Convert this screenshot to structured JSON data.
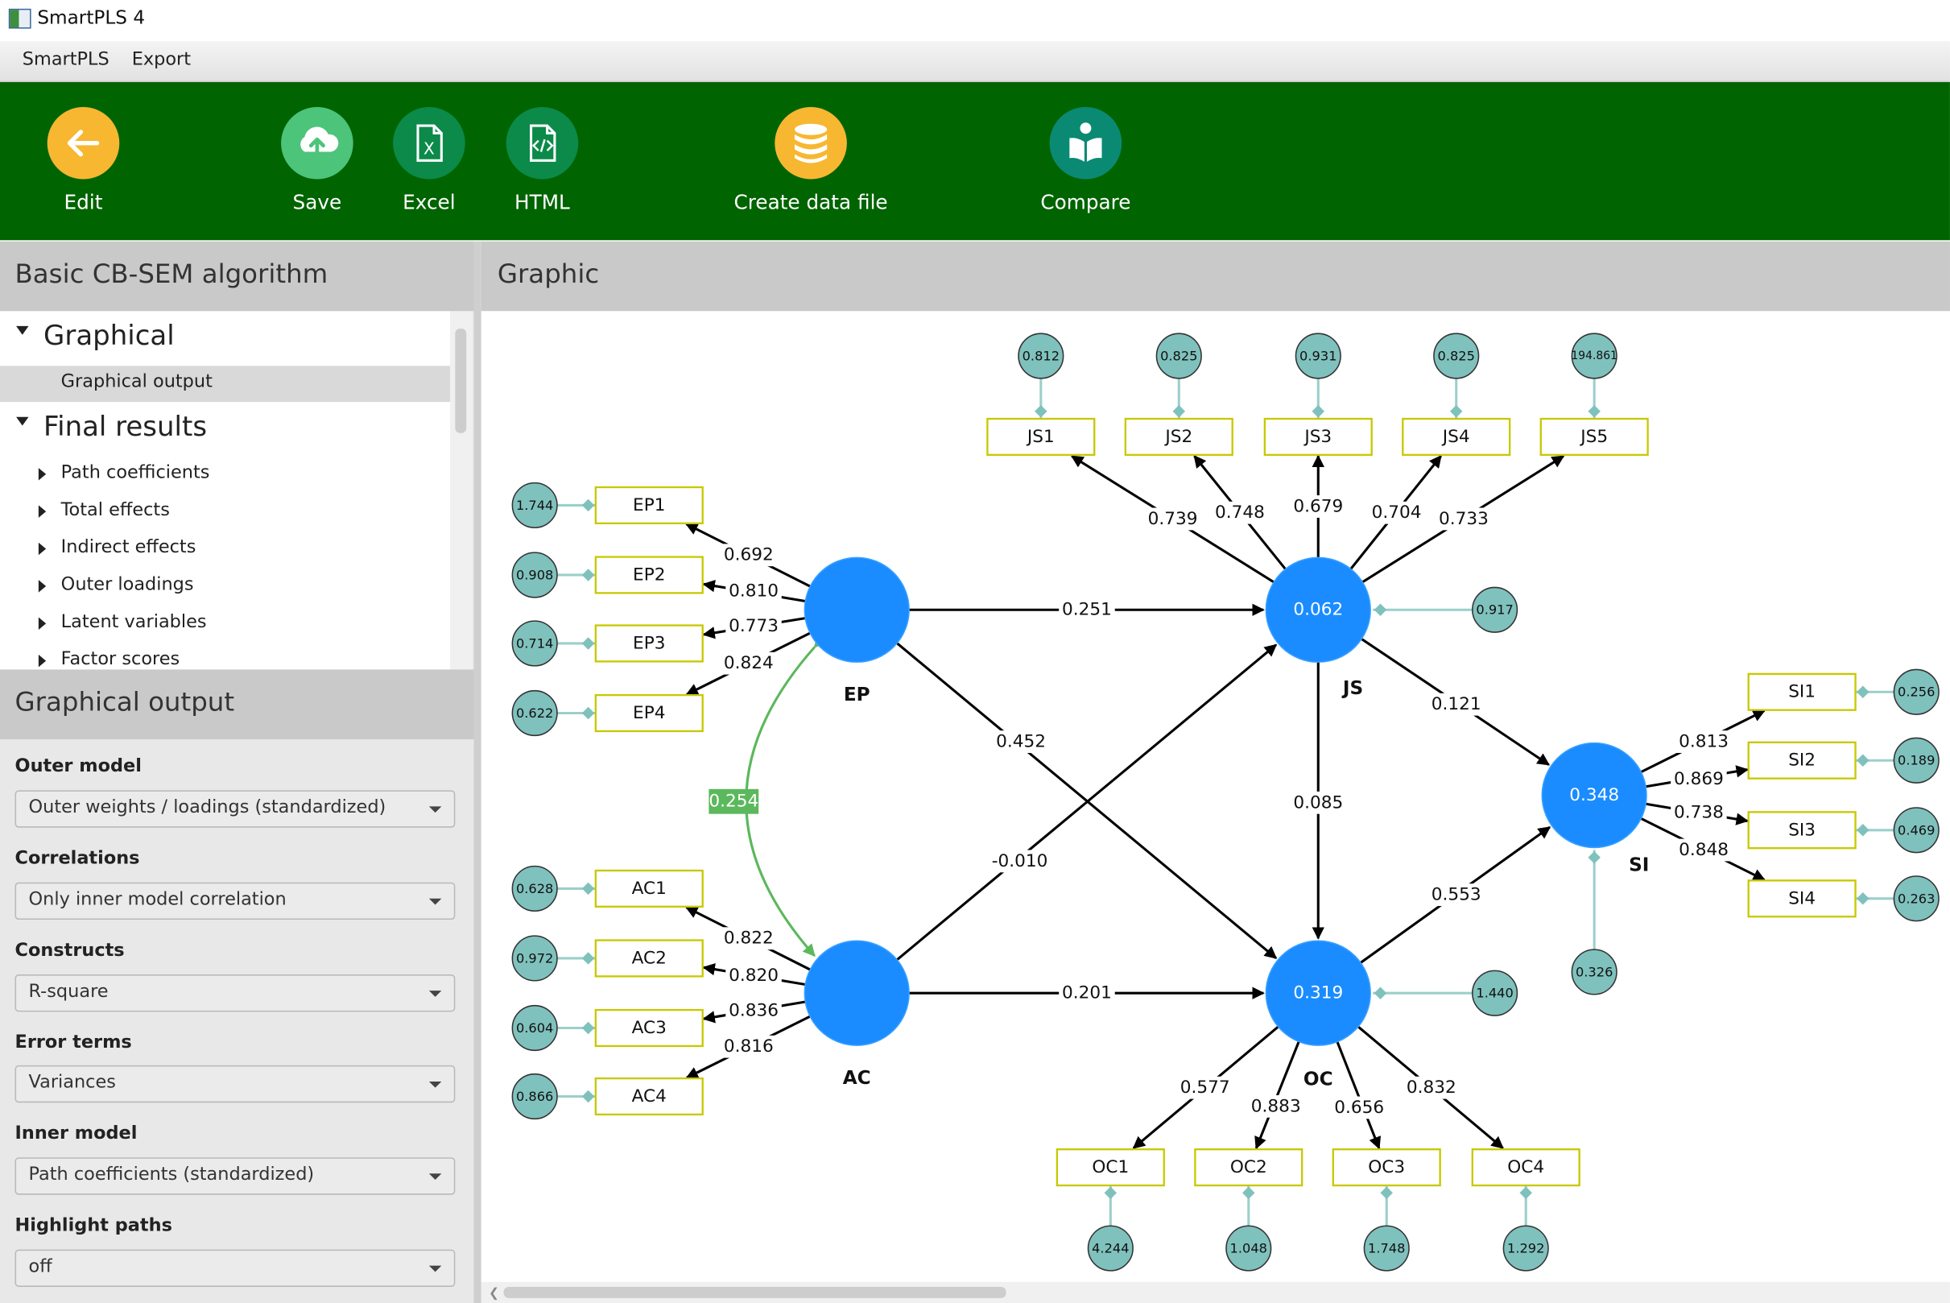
{
  "window": {
    "title": "SmartPLS 4"
  },
  "menu": {
    "items": [
      "SmartPLS",
      "Export"
    ]
  },
  "toolbar": {
    "edit": "Edit",
    "save": "Save",
    "excel": "Excel",
    "html": "HTML",
    "create_data_file": "Create data file",
    "compare": "Compare",
    "colors": {
      "bar": "#006400",
      "edit": "#f7b731",
      "save": "#4cc47a",
      "excel": "#0b8a4a",
      "html": "#0b8a4a",
      "data": "#f7b731",
      "compare": "#0a8a73"
    }
  },
  "left": {
    "title": "Basic CB-SEM algorithm",
    "tree": {
      "graphical": "Graphical",
      "graphical_output": "Graphical output",
      "final_results": "Final results",
      "items": [
        "Path coefficients",
        "Total effects",
        "Indirect effects",
        "Outer loadings",
        "Latent variables",
        "Factor scores"
      ]
    },
    "options_title": "Graphical output",
    "options": [
      {
        "label": "Outer model",
        "value": "Outer weights / loadings (standardized)"
      },
      {
        "label": "Correlations",
        "value": "Only inner model correlation"
      },
      {
        "label": "Constructs",
        "value": "R-square"
      },
      {
        "label": "Error terms",
        "value": "Variances"
      },
      {
        "label": "Inner model",
        "value": "Path coefficients (standardized)"
      },
      {
        "label": "Highlight paths",
        "value": "off"
      }
    ]
  },
  "graphic": {
    "title": "Graphic",
    "colors": {
      "construct": "#1a8cff",
      "indicator_border": "#c8c800",
      "error_fill": "#7fc1bd",
      "error_link": "#9ccfcb",
      "correlation": "#5cb85c"
    },
    "constructs": {
      "EP": {
        "label": "EP",
        "value": ""
      },
      "AC": {
        "label": "AC",
        "value": ""
      },
      "JS": {
        "label": "JS",
        "value": "0.062"
      },
      "OC": {
        "label": "OC",
        "value": "0.319"
      },
      "SI": {
        "label": "SI",
        "value": "0.348"
      }
    },
    "construct_errors": {
      "JS": "0.917",
      "OC": "1.440",
      "SI": "0.326"
    },
    "indicators": {
      "EP": [
        {
          "name": "EP1",
          "loading": "0.692",
          "error": "1.744"
        },
        {
          "name": "EP2",
          "loading": "0.810",
          "error": "0.908"
        },
        {
          "name": "EP3",
          "loading": "0.773",
          "error": "0.714"
        },
        {
          "name": "EP4",
          "loading": "0.824",
          "error": "0.622"
        }
      ],
      "AC": [
        {
          "name": "AC1",
          "loading": "0.822",
          "error": "0.628"
        },
        {
          "name": "AC2",
          "loading": "0.820",
          "error": "0.972"
        },
        {
          "name": "AC3",
          "loading": "0.836",
          "error": "0.604"
        },
        {
          "name": "AC4",
          "loading": "0.816",
          "error": "0.866"
        }
      ],
      "JS": [
        {
          "name": "JS1",
          "loading": "0.739",
          "error": "0.812"
        },
        {
          "name": "JS2",
          "loading": "0.748",
          "error": "0.825"
        },
        {
          "name": "JS3",
          "loading": "0.679",
          "error": "0.931"
        },
        {
          "name": "JS4",
          "loading": "0.704",
          "error": "0.825"
        },
        {
          "name": "JS5",
          "loading": "0.733",
          "error": "194.861"
        }
      ],
      "OC": [
        {
          "name": "OC1",
          "loading": "0.577",
          "error": "4.244"
        },
        {
          "name": "OC2",
          "loading": "0.883",
          "error": "1.048"
        },
        {
          "name": "OC3",
          "loading": "0.656",
          "error": "1.748"
        },
        {
          "name": "OC4",
          "loading": "0.832",
          "error": "1.292"
        }
      ],
      "SI": [
        {
          "name": "SI1",
          "loading": "0.813",
          "error": "0.256"
        },
        {
          "name": "SI2",
          "loading": "0.869",
          "error": "0.189"
        },
        {
          "name": "SI3",
          "loading": "0.738",
          "error": "0.469"
        },
        {
          "name": "SI4",
          "loading": "0.848",
          "error": "0.263"
        }
      ]
    },
    "paths": [
      {
        "from": "EP",
        "to": "JS",
        "value": "0.251"
      },
      {
        "from": "EP",
        "to": "OC",
        "value": "0.452"
      },
      {
        "from": "AC",
        "to": "JS",
        "value": "-0.010"
      },
      {
        "from": "AC",
        "to": "OC",
        "value": "0.201"
      },
      {
        "from": "JS",
        "to": "OC",
        "value": "0.085"
      },
      {
        "from": "JS",
        "to": "SI",
        "value": "0.121"
      },
      {
        "from": "OC",
        "to": "SI",
        "value": "0.553"
      }
    ],
    "correlation": {
      "between": [
        "EP",
        "AC"
      ],
      "value": "0.254"
    }
  }
}
